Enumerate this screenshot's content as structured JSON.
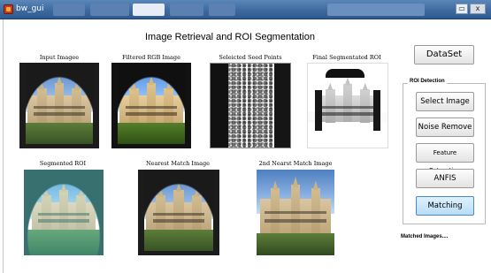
{
  "window": {
    "title": "bw_gui",
    "controls": {
      "minimize": "▭",
      "close": "x"
    }
  },
  "main_title": "Image Retrieval and ROI Segmentation",
  "images": {
    "input": "Input Imagee",
    "filtered": "Filtered RGB Image",
    "seed": "Seleicted Seed Points",
    "final": "Final Segmentated ROI",
    "segmented": "Segmented ROI",
    "nearest": "Nearest Match Image",
    "second_nearest": "2nd Nearst Match Image"
  },
  "buttons": {
    "dataset": "DataSet",
    "select_image": "Select Image",
    "noise_remove": "Noise Remove",
    "feature_extraction": "Feature Extraction",
    "anfis": "ANFIS",
    "matching": "Matching"
  },
  "group": {
    "label": "ROI Detection"
  },
  "status": {
    "matched": "Matched Images...."
  },
  "colors": {
    "active_button": "#b9dcf5",
    "titlebar": "#3e6aa0"
  }
}
